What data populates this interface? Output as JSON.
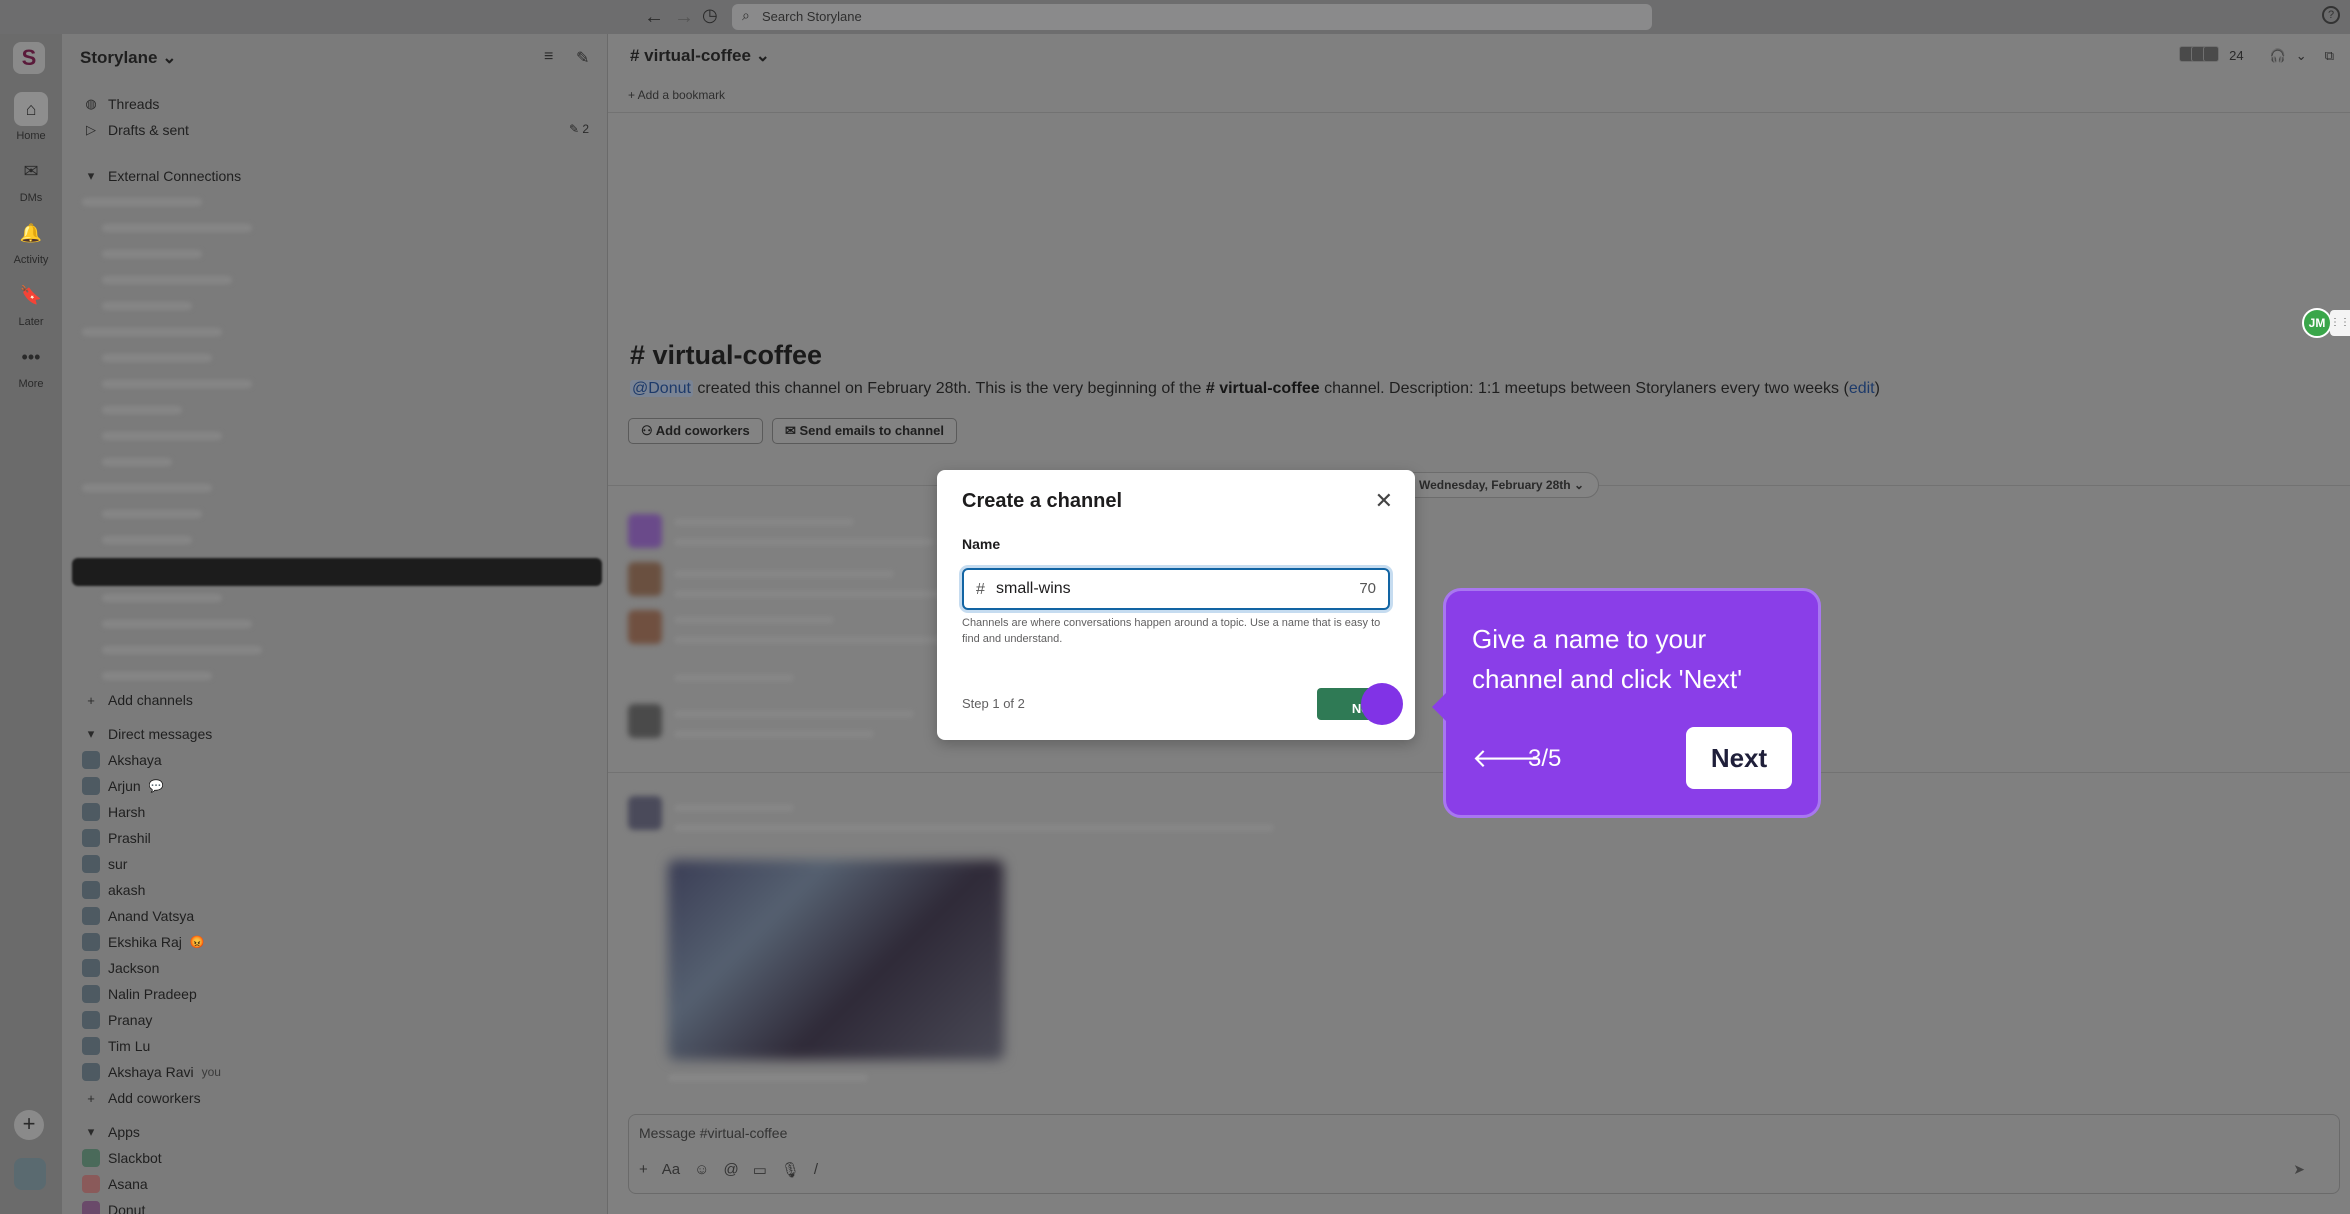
{
  "topbar": {
    "back_icon": "←",
    "forward_icon": "→",
    "history_icon": "◷",
    "search_placeholder": "Search Storylane",
    "help_icon": "?"
  },
  "rail": {
    "logo": "S",
    "items": [
      {
        "label": "Home",
        "icon": "⌂"
      },
      {
        "label": "DMs",
        "icon": "✉"
      },
      {
        "label": "Activity",
        "icon": "🔔"
      },
      {
        "label": "Later",
        "icon": "🔖"
      },
      {
        "label": "More",
        "icon": "•••"
      }
    ],
    "add_icon": "+"
  },
  "sidebar": {
    "workspace_name": "Storylane ⌄",
    "filter_icon": "≡",
    "compose_icon": "✎",
    "threads_label": "Threads",
    "drafts_label": "Drafts & sent",
    "drafts_count": "✎ 2",
    "external_section": "External Connections",
    "add_channels_label": "Add channels",
    "dm_section": "Direct messages",
    "dms": [
      {
        "name": "Akshaya",
        "extra": ""
      },
      {
        "name": "Arjun",
        "extra": "💬"
      },
      {
        "name": "Harsh",
        "extra": ""
      },
      {
        "name": "Prashil",
        "extra": ""
      },
      {
        "name": "sur",
        "extra": ""
      },
      {
        "name": "akash",
        "extra": ""
      },
      {
        "name": "Anand Vatsya",
        "extra": ""
      },
      {
        "name": "Ekshika Raj",
        "extra": "😡"
      },
      {
        "name": "Jackson",
        "extra": ""
      },
      {
        "name": "Nalin Pradeep",
        "extra": ""
      },
      {
        "name": "Pranay",
        "extra": ""
      },
      {
        "name": "Tim Lu",
        "extra": ""
      },
      {
        "name": "Akshaya Ravi",
        "extra": "you"
      }
    ],
    "add_coworkers_label": "Add coworkers",
    "apps_section": "Apps",
    "apps": [
      "Slackbot",
      "Asana",
      "Donut"
    ]
  },
  "channel": {
    "header_title": "# virtual-coffee ⌄",
    "member_count": "24",
    "bookmark_label": "+ Add a bookmark",
    "intro_title": "# virtual-coffee",
    "intro_mention": "@Donut",
    "intro_text_1": " created this channel on February 28th. This is the very beginning of the ",
    "intro_channel": "# virtual-coffee",
    "intro_text_2": " channel. Description: 1:1 meetups between Storylaners every two weeks (",
    "intro_edit": "edit",
    "intro_text_3": ")",
    "add_coworkers_btn": "⚇ Add coworkers",
    "send_emails_btn": "✉ Send emails to channel",
    "date_divider": "Wednesday, February 28th ⌄",
    "composer_placeholder": "Message #virtual-coffee",
    "composer_tools": [
      "+",
      "Aa",
      "☺",
      "@",
      "▭",
      "🎙",
      "/"
    ],
    "send_icon": "➤",
    "jm_badge": "JM"
  },
  "modal": {
    "title": "Create a channel",
    "close_icon": "✕",
    "name_label": "Name",
    "hash": "#",
    "name_value": "small-wins",
    "char_count": "70",
    "helper": "Channels are where conversations happen around a topic. Use a name that is easy to find and understand.",
    "step": "Step 1 of 2",
    "next_label": "Next"
  },
  "tooltip": {
    "text": "Give a name to your channel and click 'Next'",
    "back_icon": "🡐",
    "progress": "3/5",
    "next_label": "Next"
  },
  "colors": {
    "tooltip_purple": "#8a3ee8",
    "next_green": "#2f7a55",
    "focus_blue": "#1264a3"
  }
}
